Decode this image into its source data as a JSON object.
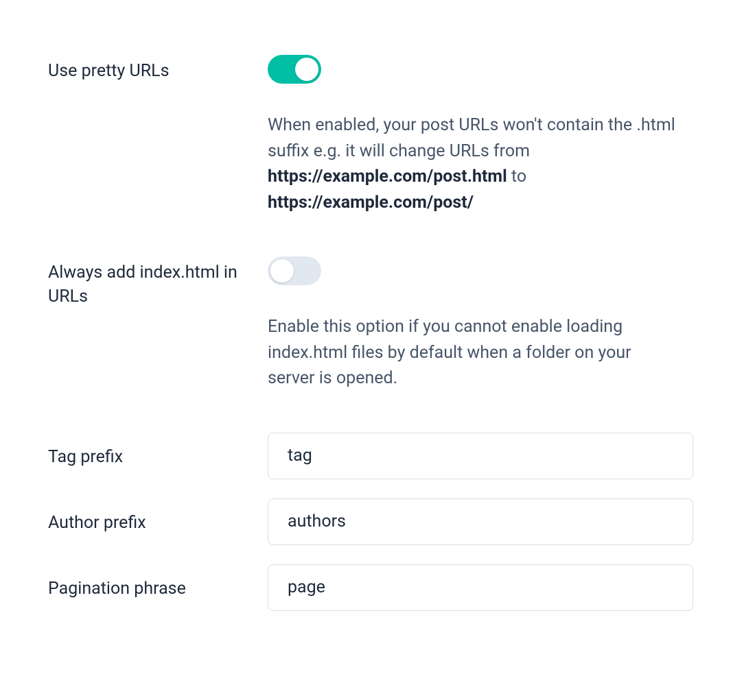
{
  "settings": {
    "pretty_urls": {
      "label": "Use pretty URLs",
      "enabled": true,
      "description_prefix": "When enabled, your post URLs won't contain the .html suffix e.g. it will change URLs from ",
      "description_bold1": "https://example.com/post.html",
      "description_mid": " to ",
      "description_bold2": "https://example.com/post/"
    },
    "always_index": {
      "label": "Always add index.html in URLs",
      "enabled": false,
      "description": "Enable this option if you cannot enable loading index.html files by default when a folder on your server is opened."
    },
    "tag_prefix": {
      "label": "Tag prefix",
      "value": "tag"
    },
    "author_prefix": {
      "label": "Author prefix",
      "value": "authors"
    },
    "pagination_phrase": {
      "label": "Pagination phrase",
      "value": "page"
    }
  }
}
